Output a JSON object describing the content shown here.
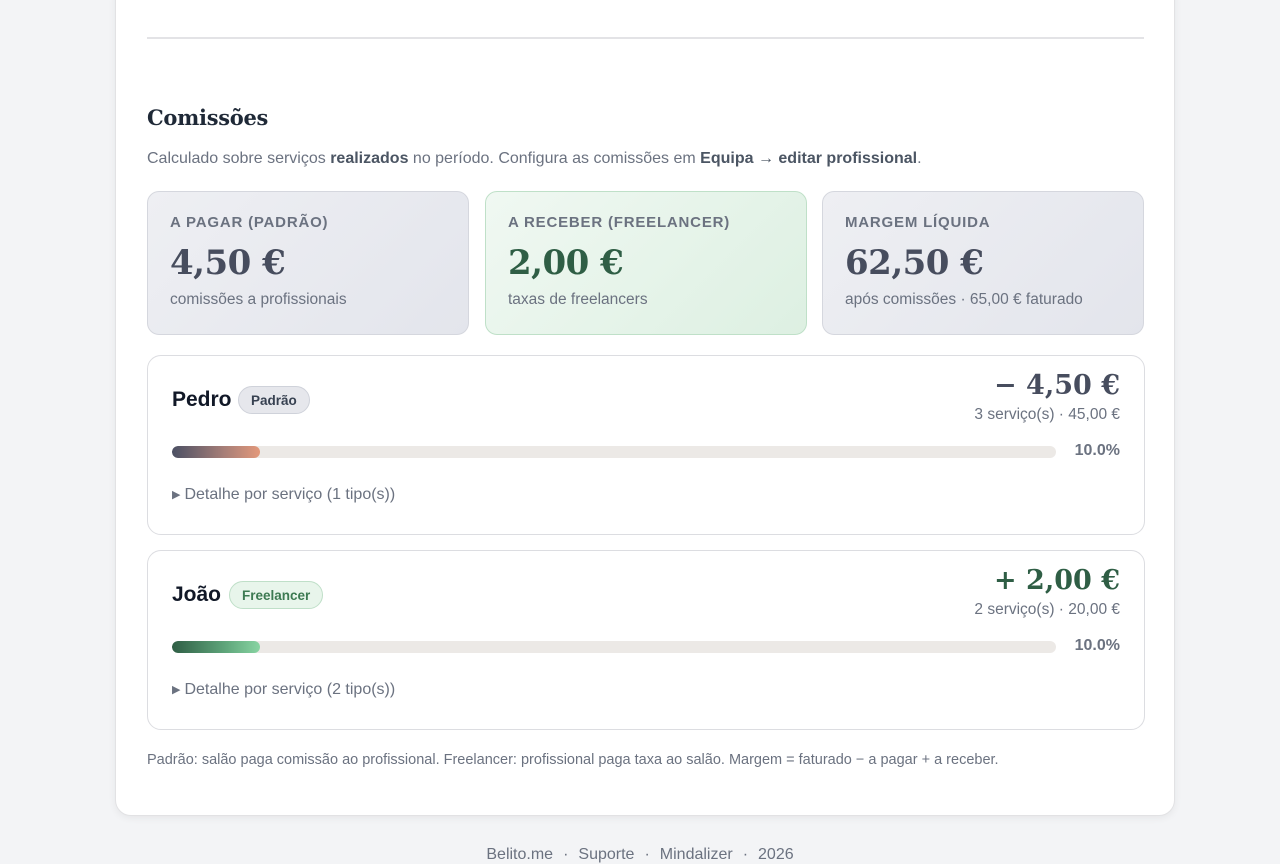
{
  "section": {
    "title": "Comissões",
    "intro": {
      "part1": "Calculado sobre serviços ",
      "bold1": "realizados",
      "part2": " no período. Configura as comissões em ",
      "bold2": "Equipa → editar profissional",
      "part3": "."
    }
  },
  "stats": [
    {
      "label": "A PAGAR (PADRÃO)",
      "value": "4,50 €",
      "sub": "comissões a profissionais"
    },
    {
      "label": "A RECEBER (FREELANCER)",
      "value": "2,00 €",
      "sub": "taxas de freelancers"
    },
    {
      "label": "MARGEM LÍQUIDA",
      "value": "62,50 €",
      "sub": "após comissões · 65,00 € faturado"
    }
  ],
  "people": [
    {
      "name": "Pedro",
      "badge": "Padrão",
      "amount": "− 4,50 €",
      "meta": "3 serviço(s) · 45,00 €",
      "percent_label": "10.0%",
      "percent": 10.0,
      "details": "Detalhe por serviço (1 tipo(s))"
    },
    {
      "name": "João",
      "badge": "Freelancer",
      "amount": "+ 2,00 €",
      "meta": "2 serviço(s) · 20,00 €",
      "percent_label": "10.0%",
      "percent": 10.0,
      "details": "Detalhe por serviço (2 tipo(s))"
    }
  ],
  "footnote": "Padrão: salão paga comissão ao profissional. Freelancer: profissional paga taxa ao salão. Margem = faturado − a pagar + a receber.",
  "footer": {
    "links": [
      "Belito.me",
      "Suporte",
      "Mindalizer"
    ],
    "year": "2026",
    "separator": "·"
  },
  "colors": {
    "positive": "#2f5e45",
    "neutral_value": "#474d5e",
    "bar_padrao_end": "#e3987a",
    "bar_freelancer_end": "#88d4a2"
  }
}
